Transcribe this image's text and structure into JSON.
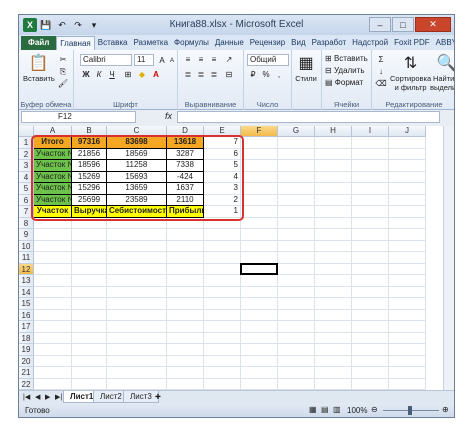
{
  "window": {
    "title": "Книга88.xlsx - Microsoft Excel",
    "minimize": "–",
    "maximize": "□",
    "close": "✕",
    "app_icon": "X"
  },
  "ribbon": {
    "tabs": [
      "Файл",
      "Главная",
      "Вставка",
      "Разметка",
      "Формулы",
      "Данные",
      "Рецензир",
      "Вид",
      "Разработ",
      "Надстрой",
      "Foxit PDF",
      "ABBYY PC"
    ],
    "active_tab": "Главная",
    "clipboard": {
      "paste_label": "Вставить",
      "group_label": "Буфер обмена"
    },
    "font": {
      "name": "Calibri",
      "size": "11",
      "group_label": "Шрифт",
      "bold": "Ж",
      "italic": "К",
      "underline": "Ч"
    },
    "alignment": {
      "group_label": "Выравнивание"
    },
    "number": {
      "format": "Общий",
      "group_label": "Число"
    },
    "styles": {
      "label": "Стили"
    },
    "cells": {
      "insert": "Вставить",
      "delete": "Удалить",
      "format": "Формат",
      "group_label": "Ячейки"
    },
    "editing": {
      "sort": "Сортировка",
      "sort2": "и фильтр",
      "find": "Найти и",
      "find2": "выделить",
      "group_label": "Редактирование"
    }
  },
  "formula_bar": {
    "cell_ref": "F12",
    "fx": "fx",
    "value": ""
  },
  "columns": [
    "A",
    "B",
    "C",
    "D",
    "E",
    "F",
    "G",
    "H",
    "I",
    "J"
  ],
  "selected_column": "F",
  "rows": [
    "1",
    "2",
    "3",
    "4",
    "5",
    "6",
    "7",
    "8",
    "9",
    "10",
    "11",
    "12",
    "13",
    "14",
    "15",
    "16",
    "17",
    "18",
    "19",
    "20",
    "21",
    "22"
  ],
  "selected_row": "12",
  "table": {
    "header_row": [
      "Итого",
      "97316",
      "83698",
      "13618",
      "7"
    ],
    "data_rows": [
      [
        "Участок №5",
        "21856",
        "18569",
        "3287",
        "6"
      ],
      [
        "Участок №4",
        "18596",
        "11258",
        "7338",
        "5"
      ],
      [
        "Участок №3",
        "15269",
        "15693",
        "-424",
        "4"
      ],
      [
        "Участок №2",
        "15296",
        "13659",
        "1637",
        "3"
      ],
      [
        "Участок №1",
        "25699",
        "23589",
        "2110",
        "2"
      ]
    ],
    "footer_row": [
      "Участок",
      "Выручка",
      "Себистоимость",
      "Прибыль",
      "1"
    ]
  },
  "sheets": [
    "Лист1",
    "Лист2",
    "Лист3"
  ],
  "active_sheet": "Лист1",
  "status": {
    "mode": "Готово",
    "zoom": "100%"
  },
  "colors": {
    "total_fill": "#f5a623",
    "label_fill": "#6cc24a",
    "footer_fill": "#ffff00",
    "highlight_border": "#d93030"
  }
}
